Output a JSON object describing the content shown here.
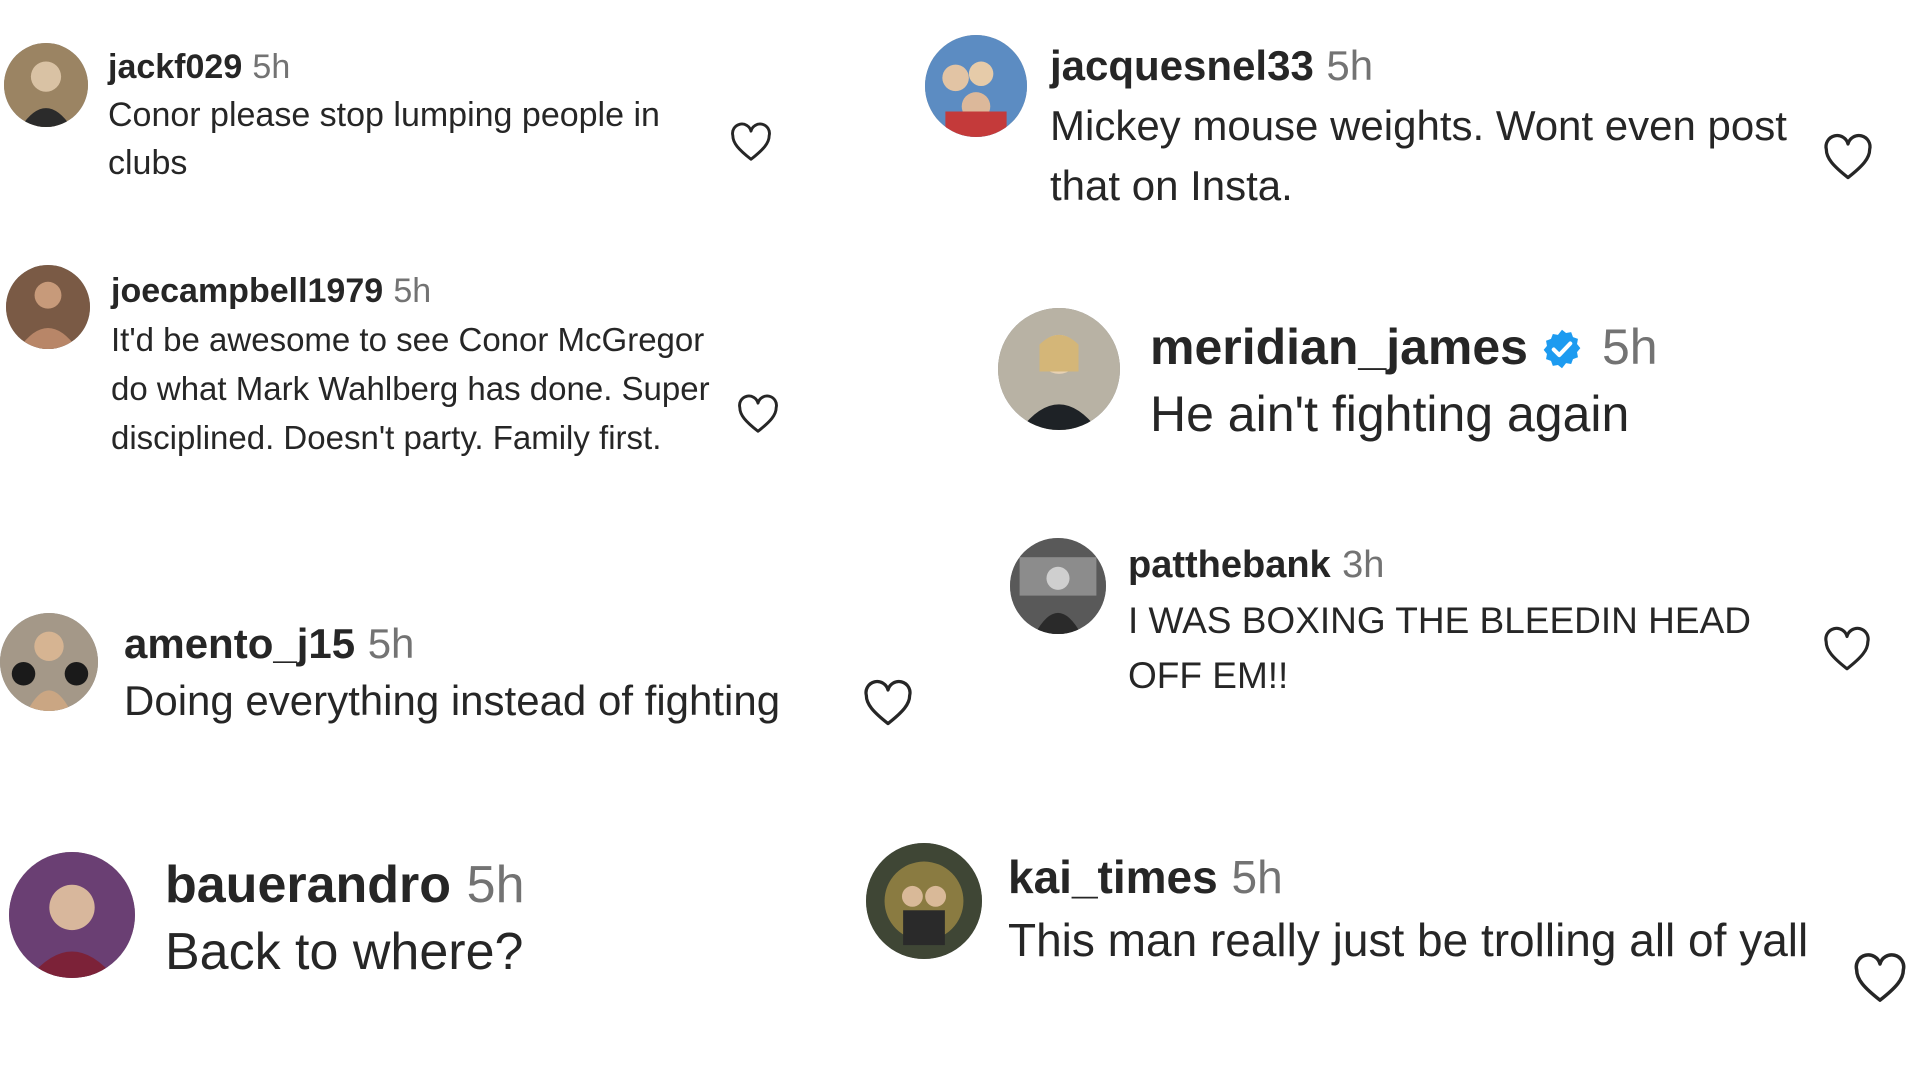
{
  "comments": [
    {
      "username": "jackf029",
      "time": "5h",
      "text": "Conor please stop lumping people in clubs",
      "verified": false,
      "avatar_color": "#9b8463"
    },
    {
      "username": "jacquesnel33",
      "time": "5h",
      "text": "Mickey mouse weights. Wont even post that on Insta.",
      "verified": false,
      "avatar_color": "#5c8cc2"
    },
    {
      "username": "joecampbell1979",
      "time": "5h",
      "text": "It'd be awesome to see Conor McGregor do what Mark Wahlberg has done. Super disciplined. Doesn't party. Family first.",
      "verified": false,
      "avatar_color": "#7a5a45"
    },
    {
      "username": "meridian_james",
      "time": "5h",
      "text": "He ain't fighting again",
      "verified": true,
      "avatar_color": "#b8b2a4"
    },
    {
      "username": "amento_j15",
      "time": "5h",
      "text": "Doing everything instead of fighting",
      "verified": false,
      "avatar_color": "#a49888"
    },
    {
      "username": "patthebank",
      "time": "3h",
      "text": "I WAS BOXING THE BLEEDIN HEAD OFF EM!!",
      "verified": false,
      "avatar_color": "#595959"
    },
    {
      "username": "bauerandro",
      "time": "5h",
      "text": "Back to where?",
      "verified": false,
      "avatar_color": "#6a3f73"
    },
    {
      "username": "kai_times",
      "time": "5h",
      "text": "This man really just be trolling all of yall",
      "verified": false,
      "avatar_color": "#3f4635"
    }
  ],
  "colors": {
    "text": "#262626",
    "secondary": "#737373",
    "verified": "#1d9bf0",
    "background": "#ffffff"
  },
  "icons": {
    "like": "heart-outline-icon",
    "verified": "verified-badge-icon"
  }
}
